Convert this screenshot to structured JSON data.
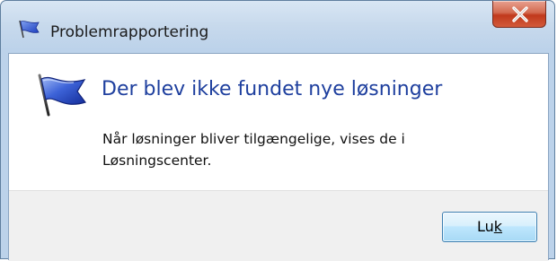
{
  "window": {
    "title": "Problemrapportering",
    "title_icon": "flag-icon",
    "close_icon": "close-icon"
  },
  "content": {
    "icon": "flag-icon",
    "main_instruction": "Der blev ikke fundet nye løsninger",
    "body_line_1": "Når løsninger bliver tilgængelige, vises de i",
    "body_line_2": "Løsningscenter."
  },
  "footer": {
    "close_button": {
      "label_before": "Lu",
      "label_underlined": "k",
      "label_after": ""
    }
  },
  "colors": {
    "instruction_blue": "#1e3f9e",
    "close_red": "#c0391c",
    "button_border": "#3c7fb1"
  }
}
